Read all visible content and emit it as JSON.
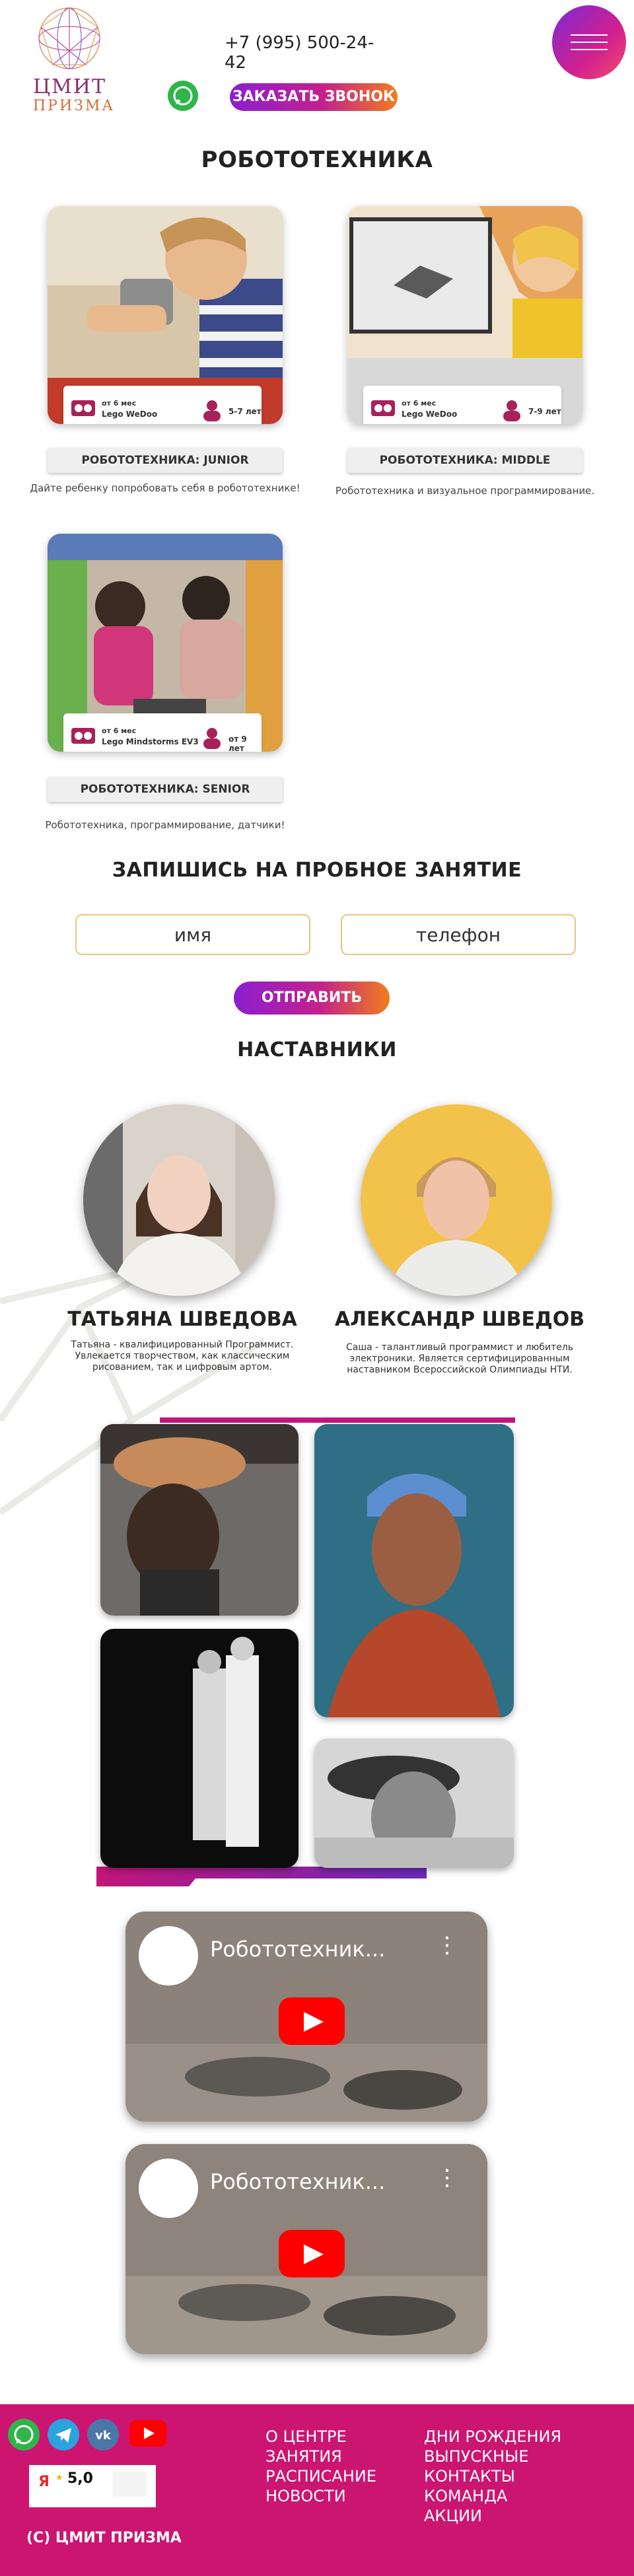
{
  "header": {
    "logo_line1": "ЦМИТ",
    "logo_line2": "ПРИЗМА",
    "phone": "+7 (995) 500-24-42",
    "call_button": "ЗАКАЗАТЬ ЗВОНОК",
    "whatsapp_icon": "whatsapp-icon",
    "menu_icon": "hamburger-menu-icon"
  },
  "courses": {
    "title": "РОБОТОТЕХНИКА",
    "items": [
      {
        "duration": "от 6 мес",
        "kit": "Lego WeDoo",
        "age": "5-7 лет",
        "label": "РОБОТОТЕХНИКА: JUNIOR",
        "desc": "Дайте ребенку попробовать себя в робототехнике!"
      },
      {
        "duration": "от 6 мес",
        "kit": "Lego WeDoo",
        "age": "7-9 лет",
        "label": "РОБОТОТЕХНИКА: MIDDLE",
        "desc": "Робототехника и визуальное программирование."
      },
      {
        "duration": "от 6 мес",
        "kit": "Lego Mindstorms EV3",
        "age": "от 9 лет",
        "label": "РОБОТОТЕХНИКА: SENIOR",
        "desc": "Робототехника, программирование, датчики!"
      }
    ]
  },
  "form": {
    "title": "ЗАПИШИСЬ НА ПРОБНОЕ ЗАНЯТИЕ",
    "name_placeholder": "имя",
    "phone_placeholder": "телефон",
    "submit": "ОТПРАВИТЬ"
  },
  "mentors": {
    "title": "НАСТАВНИКИ",
    "items": [
      {
        "name": "ТАТЬЯНА ШВЕДОВА",
        "bio": "Татьяна - квалифицированный Программист. Увлекается творчеством, как классическим рисованием, так и цифровым артом."
      },
      {
        "name": "АЛЕКСАНДР ШВЕДОВ",
        "bio": "Саша - талантливый программист и любитель электроники. Является сертифицированным наставником Всероссийской Олимпиады НТИ."
      }
    ]
  },
  "videos": [
    {
      "title": "Робототехник..."
    },
    {
      "title": "Робототехник..."
    }
  ],
  "footer": {
    "social_icons": [
      "whatsapp-icon",
      "telegram-icon",
      "vk-icon",
      "youtube-icon"
    ],
    "rating_value": "5,0",
    "col1": [
      "О ЦЕНТРЕ",
      "ЗАНЯТИЯ",
      "РАСПИСАНИЕ",
      "НОВОСТИ"
    ],
    "col2": [
      "ДНИ РОЖДЕНИЯ",
      "ВЫПУСКНЫЕ",
      "КОНТАКТЫ",
      "КОМАНДА",
      "АКЦИИ"
    ],
    "copyright": "(C) ЦМИТ ПРИЗМА"
  },
  "colors": {
    "accent_gradient_start": "#8a1fd0",
    "accent_gradient_end": "#f07d1c",
    "footer_bg": "#cc1471"
  }
}
